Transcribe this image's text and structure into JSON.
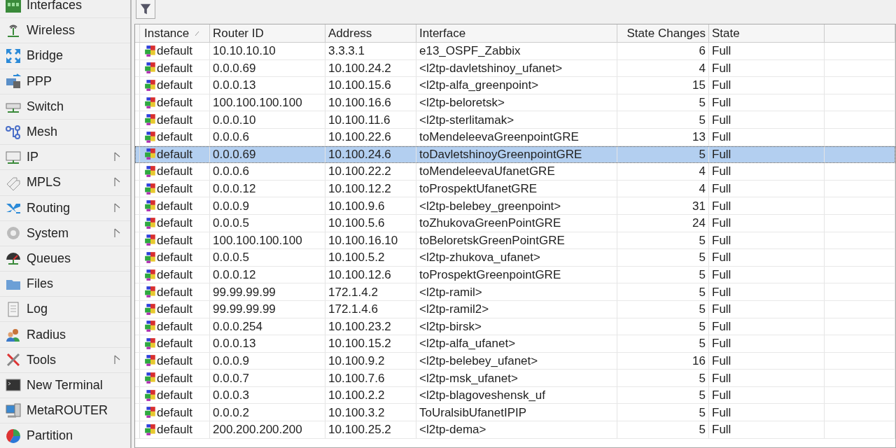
{
  "sidebar": {
    "items": [
      {
        "label": "Interfaces",
        "submenu": false
      },
      {
        "label": "Wireless",
        "submenu": false
      },
      {
        "label": "Bridge",
        "submenu": false
      },
      {
        "label": "PPP",
        "submenu": false
      },
      {
        "label": "Switch",
        "submenu": false
      },
      {
        "label": "Mesh",
        "submenu": false
      },
      {
        "label": "IP",
        "submenu": true
      },
      {
        "label": "MPLS",
        "submenu": true
      },
      {
        "label": "Routing",
        "submenu": true
      },
      {
        "label": "System",
        "submenu": true
      },
      {
        "label": "Queues",
        "submenu": false
      },
      {
        "label": "Files",
        "submenu": false
      },
      {
        "label": "Log",
        "submenu": false
      },
      {
        "label": "Radius",
        "submenu": false
      },
      {
        "label": "Tools",
        "submenu": true
      },
      {
        "label": "New Terminal",
        "submenu": false
      },
      {
        "label": "MetaROUTER",
        "submenu": false
      },
      {
        "label": "Partition",
        "submenu": false
      }
    ]
  },
  "table": {
    "columns": [
      {
        "label": "Instance",
        "sorted": true
      },
      {
        "label": "Router ID",
        "sorted": false
      },
      {
        "label": "Address",
        "sorted": false
      },
      {
        "label": "Interface",
        "sorted": false
      },
      {
        "label": "State Changes",
        "sorted": false
      },
      {
        "label": "State",
        "sorted": false
      }
    ],
    "rows": [
      {
        "instance": "default",
        "router_id": "10.10.10.10",
        "address": "3.3.3.1",
        "interface": "e13_OSPF_Zabbix",
        "state_changes": "6",
        "state": "Full",
        "selected": false
      },
      {
        "instance": "default",
        "router_id": "0.0.0.69",
        "address": "10.100.24.2",
        "interface": "<l2tp-davletshinoy_ufanet>",
        "state_changes": "4",
        "state": "Full",
        "selected": false
      },
      {
        "instance": "default",
        "router_id": "0.0.0.13",
        "address": "10.100.15.6",
        "interface": "<l2tp-alfa_greenpoint>",
        "state_changes": "15",
        "state": "Full",
        "selected": false
      },
      {
        "instance": "default",
        "router_id": "100.100.100.100",
        "address": "10.100.16.6",
        "interface": "<l2tp-beloretsk>",
        "state_changes": "5",
        "state": "Full",
        "selected": false
      },
      {
        "instance": "default",
        "router_id": "0.0.0.10",
        "address": "10.100.11.6",
        "interface": "<l2tp-sterlitamak>",
        "state_changes": "5",
        "state": "Full",
        "selected": false
      },
      {
        "instance": "default",
        "router_id": "0.0.0.6",
        "address": "10.100.22.6",
        "interface": "toMendeleevaGreenpointGRE",
        "state_changes": "13",
        "state": "Full",
        "selected": false
      },
      {
        "instance": "default",
        "router_id": "0.0.0.69",
        "address": "10.100.24.6",
        "interface": "toDavletshinoyGreenpointGRE",
        "state_changes": "5",
        "state": "Full",
        "selected": true
      },
      {
        "instance": "default",
        "router_id": "0.0.0.6",
        "address": "10.100.22.2",
        "interface": "toMendeleevaUfanetGRE",
        "state_changes": "4",
        "state": "Full",
        "selected": false
      },
      {
        "instance": "default",
        "router_id": "0.0.0.12",
        "address": "10.100.12.2",
        "interface": "toProspektUfanetGRE",
        "state_changes": "4",
        "state": "Full",
        "selected": false
      },
      {
        "instance": "default",
        "router_id": "0.0.0.9",
        "address": "10.100.9.6",
        "interface": "<l2tp-belebey_greenpoint>",
        "state_changes": "31",
        "state": "Full",
        "selected": false
      },
      {
        "instance": "default",
        "router_id": "0.0.0.5",
        "address": "10.100.5.6",
        "interface": "toZhukovaGreenPointGRE",
        "state_changes": "24",
        "state": "Full",
        "selected": false
      },
      {
        "instance": "default",
        "router_id": "100.100.100.100",
        "address": "10.100.16.10",
        "interface": "toBeloretskGreenPointGRE",
        "state_changes": "5",
        "state": "Full",
        "selected": false
      },
      {
        "instance": "default",
        "router_id": "0.0.0.5",
        "address": "10.100.5.2",
        "interface": "<l2tp-zhukova_ufanet>",
        "state_changes": "5",
        "state": "Full",
        "selected": false
      },
      {
        "instance": "default",
        "router_id": "0.0.0.12",
        "address": "10.100.12.6",
        "interface": "toProspektGreenpointGRE",
        "state_changes": "5",
        "state": "Full",
        "selected": false
      },
      {
        "instance": "default",
        "router_id": "99.99.99.99",
        "address": "172.1.4.2",
        "interface": "<l2tp-ramil>",
        "state_changes": "5",
        "state": "Full",
        "selected": false
      },
      {
        "instance": "default",
        "router_id": "99.99.99.99",
        "address": "172.1.4.6",
        "interface": "<l2tp-ramil2>",
        "state_changes": "5",
        "state": "Full",
        "selected": false
      },
      {
        "instance": "default",
        "router_id": "0.0.0.254",
        "address": "10.100.23.2",
        "interface": "<l2tp-birsk>",
        "state_changes": "5",
        "state": "Full",
        "selected": false
      },
      {
        "instance": "default",
        "router_id": "0.0.0.13",
        "address": "10.100.15.2",
        "interface": "<l2tp-alfa_ufanet>",
        "state_changes": "5",
        "state": "Full",
        "selected": false
      },
      {
        "instance": "default",
        "router_id": "0.0.0.9",
        "address": "10.100.9.2",
        "interface": "<l2tp-belebey_ufanet>",
        "state_changes": "16",
        "state": "Full",
        "selected": false
      },
      {
        "instance": "default",
        "router_id": "0.0.0.7",
        "address": "10.100.7.6",
        "interface": "<l2tp-msk_ufanet>",
        "state_changes": "5",
        "state": "Full",
        "selected": false
      },
      {
        "instance": "default",
        "router_id": "0.0.0.3",
        "address": "10.100.2.2",
        "interface": "<l2tp-blagoveshensk_uf",
        "state_changes": "5",
        "state": "Full",
        "selected": false
      },
      {
        "instance": "default",
        "router_id": "0.0.0.2",
        "address": "10.100.3.2",
        "interface": "ToUralsibUfanetIPIP",
        "state_changes": "5",
        "state": "Full",
        "selected": false
      },
      {
        "instance": "default",
        "router_id": "200.200.200.200",
        "address": "10.100.25.2",
        "interface": "<l2tp-dema>",
        "state_changes": "5",
        "state": "Full",
        "selected": false
      }
    ]
  }
}
